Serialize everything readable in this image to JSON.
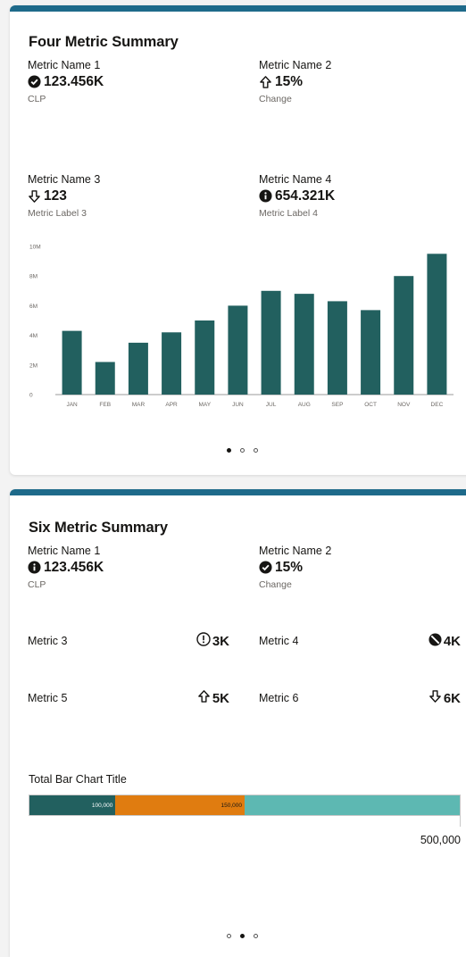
{
  "card1": {
    "title": "Four Metric Summary",
    "metrics": [
      {
        "name": "Metric Name 1",
        "icon": "check-circle-icon",
        "value": "123.456K",
        "label": "CLP"
      },
      {
        "name": "Metric Name 2",
        "icon": "arrow-up-icon",
        "value": "15%",
        "label": "Change"
      },
      {
        "name": "Metric Name 3",
        "icon": "arrow-down-icon",
        "value": "123",
        "label": "Metric Label 3"
      },
      {
        "name": "Metric Name 4",
        "icon": "info-circle-icon",
        "value": "654.321K",
        "label": "Metric Label 4"
      }
    ],
    "carousel": {
      "pages": 3,
      "active": 0
    }
  },
  "chart_data": {
    "type": "bar",
    "categories": [
      "JAN",
      "FEB",
      "MAR",
      "APR",
      "MAY",
      "JUN",
      "JUL",
      "AUG",
      "SEP",
      "OCT",
      "NOV",
      "DEC"
    ],
    "values": [
      4.3,
      2.2,
      3.5,
      4.2,
      5.0,
      6.0,
      7.0,
      6.8,
      6.3,
      5.7,
      8.0,
      9.5
    ],
    "yticks": [
      "0",
      "2M",
      "4M",
      "6M",
      "8M",
      "10M"
    ],
    "ylim": [
      0,
      10
    ],
    "color": "#22605f",
    "grid": false,
    "title": "",
    "xlabel": "",
    "ylabel": ""
  },
  "card2": {
    "title": "Six Metric Summary",
    "metrics": [
      {
        "name": "Metric Name 1",
        "icon": "info-circle-icon",
        "value": "123.456K",
        "label": "CLP"
      },
      {
        "name": "Metric Name 2",
        "icon": "check-circle-icon",
        "value": "15%",
        "label": "Change"
      }
    ],
    "small_metrics": [
      {
        "name": "Metric 3",
        "icon": "warning-circle-icon",
        "value": "3K"
      },
      {
        "name": "Metric 4",
        "icon": "blocked-icon",
        "value": "4K"
      },
      {
        "name": "Metric 5",
        "icon": "arrow-up-icon",
        "value": "5K"
      },
      {
        "name": "Metric 6",
        "icon": "arrow-down-icon",
        "value": "6K"
      }
    ],
    "total_bar": {
      "title": "Total Bar Chart Title",
      "total": 500000,
      "total_label": "500,000",
      "segments": [
        {
          "value": 100000,
          "label": "100,000",
          "color": "#22605f",
          "text_color": "#ffffff"
        },
        {
          "value": 150000,
          "label": "150,000",
          "color": "#e07c10",
          "text_color": "#161513"
        },
        {
          "value": 250000,
          "label": "",
          "color": "#5db8b2",
          "text_color": "#161513"
        }
      ]
    },
    "carousel": {
      "pages": 3,
      "active": 1
    }
  },
  "colors": {
    "accent_bar": "#1e6a8a",
    "bar": "#22605f"
  }
}
